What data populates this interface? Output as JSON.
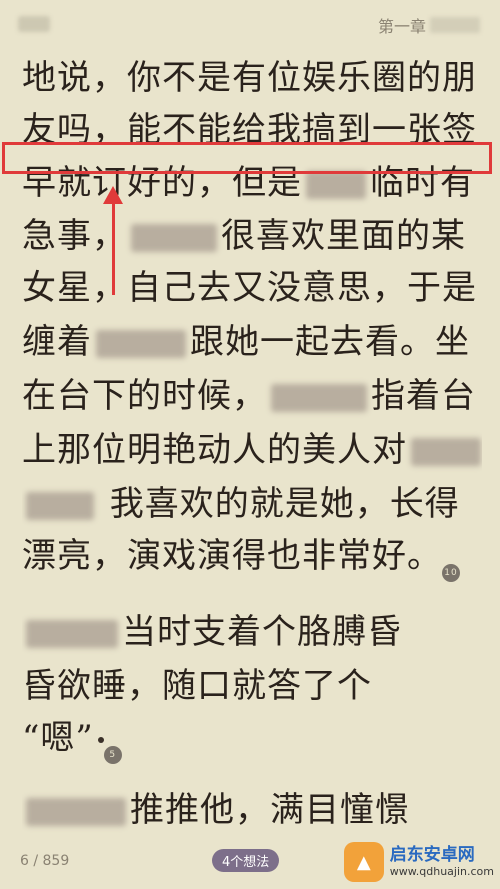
{
  "header": {
    "chapter_label": "第一章"
  },
  "reader": {
    "lines": [
      {
        "segments": [
          {
            "type": "text",
            "text": "地说，你不是有位娱乐圈的朋"
          }
        ]
      },
      {
        "segments": [
          {
            "type": "text",
            "text": "友吗，能不能给我搞到一张签"
          }
        ]
      },
      {
        "segments": [
          {
            "type": "text",
            "text": "早就订好的，但是"
          },
          {
            "type": "blur",
            "w": 60
          },
          {
            "type": "text",
            "text": "临时有"
          }
        ]
      },
      {
        "segments": [
          {
            "type": "text",
            "text": "急事，"
          },
          {
            "type": "blur",
            "w": 86
          },
          {
            "type": "text",
            "text": "很喜欢里面的某"
          }
        ]
      },
      {
        "segments": [
          {
            "type": "text",
            "text": "女星，自己去又没意思，于是"
          }
        ]
      },
      {
        "segments": [
          {
            "type": "text",
            "text": "缠着"
          },
          {
            "type": "blur",
            "w": 90
          },
          {
            "type": "text",
            "text": "跟她一起去看。坐"
          }
        ]
      },
      {
        "segments": [
          {
            "type": "text",
            "text": "在台下的时候，"
          },
          {
            "type": "blur",
            "w": 96
          },
          {
            "type": "text",
            "text": "指着台"
          }
        ]
      },
      {
        "segments": [
          {
            "type": "text",
            "text": "上那位明艳动人的美人对"
          },
          {
            "type": "blur",
            "w": 70
          }
        ]
      },
      {
        "segments": [
          {
            "type": "blur",
            "w": 68
          },
          {
            "type": "text",
            "text": "  我喜欢的就是她，长得"
          }
        ]
      },
      {
        "segments": [
          {
            "type": "text",
            "text": "漂亮，演戏演得也非常好。"
          },
          {
            "type": "badge",
            "text": "10"
          }
        ]
      },
      {
        "segments": []
      },
      {
        "segments": [
          {
            "type": "text",
            "text": "    "
          },
          {
            "type": "blur",
            "w": 92
          },
          {
            "type": "text",
            "text": "当时支着个胳膊昏"
          }
        ]
      },
      {
        "segments": [
          {
            "type": "text",
            "text": "昏欲睡，随口就答了个"
          }
        ]
      },
      {
        "segments": [
          {
            "type": "text",
            "text": "“嗯”"
          },
          {
            "type": "dot"
          },
          {
            "type": "badge",
            "text": "5"
          }
        ]
      },
      {
        "segments": []
      },
      {
        "segments": [
          {
            "type": "text",
            "text": "    "
          },
          {
            "type": "blur",
            "w": 100
          },
          {
            "type": "text",
            "text": "推推他，满目憧憬"
          }
        ]
      }
    ]
  },
  "footer": {
    "page_indicator": "6 / 859",
    "thoughts_label": "4个想法",
    "watermark_title": "启东安卓网",
    "watermark_url": "www.qdhuajin.com"
  },
  "colors": {
    "background": "#e9e4cc",
    "text": "#2a221c",
    "annotation": "#e03a3a",
    "thoughts_pill": "#7d6f8a"
  }
}
